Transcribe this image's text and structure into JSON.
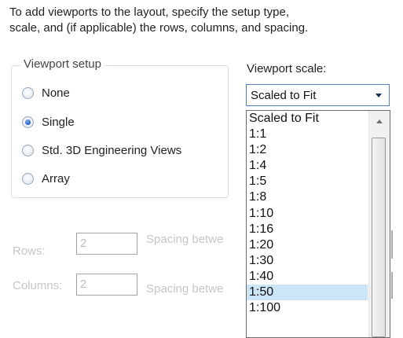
{
  "instructions": {
    "line1": "To add viewports to the layout, specify the setup type,",
    "line2": "scale, and (if applicable) the rows, columns, and spacing."
  },
  "viewport_setup": {
    "title": "Viewport setup",
    "options": [
      {
        "label": "None",
        "checked": false
      },
      {
        "label": "Single",
        "checked": true
      },
      {
        "label": "Std. 3D Engineering Views",
        "checked": false
      },
      {
        "label": "Array",
        "checked": false
      }
    ]
  },
  "grid": {
    "rows_label": "Rows:",
    "rows_value": "2",
    "columns_label": "Columns:",
    "columns_value": "2",
    "spacing_rows_label": "Spacing betwe",
    "spacing_columns_label": "Spacing betwe"
  },
  "viewport_scale": {
    "label": "Viewport scale:",
    "selected": "Scaled to Fit",
    "options": [
      "Scaled to Fit",
      "1:1",
      "1:2",
      "1:4",
      "1:5",
      "1:8",
      "1:10",
      "1:16",
      "1:20",
      "1:30",
      "1:40",
      "1:50",
      "1:100"
    ],
    "highlighted": "1:50"
  },
  "colors": {
    "highlight": "#cce5f7",
    "combo_border": "#4c7fbf",
    "disabled_text": "#c6c6c6"
  }
}
